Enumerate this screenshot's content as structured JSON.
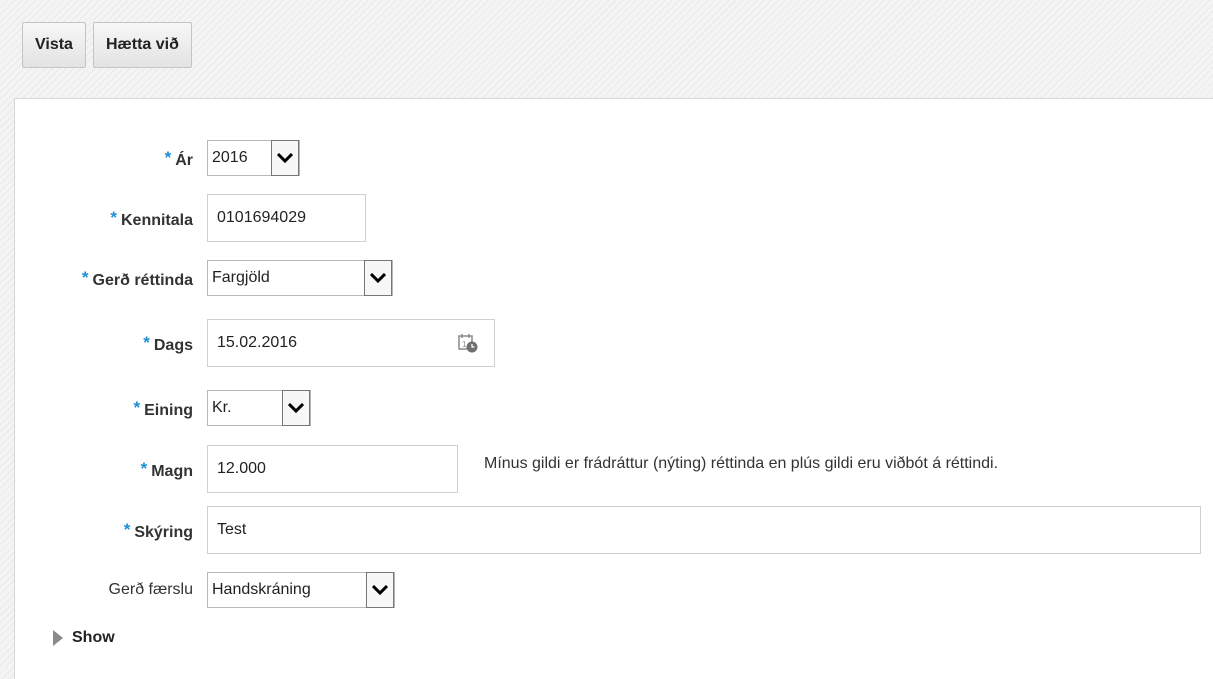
{
  "toolbar": {
    "save_label": "Vista",
    "cancel_label": "Hætta við"
  },
  "form": {
    "required_marker": "*",
    "year": {
      "label": "Ár",
      "value": "2016"
    },
    "kennitala": {
      "label": "Kennitala",
      "value": "0101694029"
    },
    "rights_type": {
      "label": "Gerð réttinda",
      "value": "Fargjöld"
    },
    "date": {
      "label": "Dags",
      "value": "15.02.2016"
    },
    "unit": {
      "label": "Eining",
      "value": "Kr."
    },
    "quantity": {
      "label": "Magn",
      "value": "12.000",
      "hint": "Mínus gildi er frádráttur (nýting) réttinda en plús gildi eru viðbót á réttindi."
    },
    "description": {
      "label": "Skýring",
      "value": "Test"
    },
    "entry_type": {
      "label": "Gerð færslu",
      "value": "Handskráning"
    },
    "show_label": "Show"
  },
  "colors": {
    "required": "#1a8fd6"
  },
  "icons": {
    "dropdown": "chevron-down-icon",
    "calendar": "calendar-icon",
    "expand": "triangle-right-icon"
  }
}
